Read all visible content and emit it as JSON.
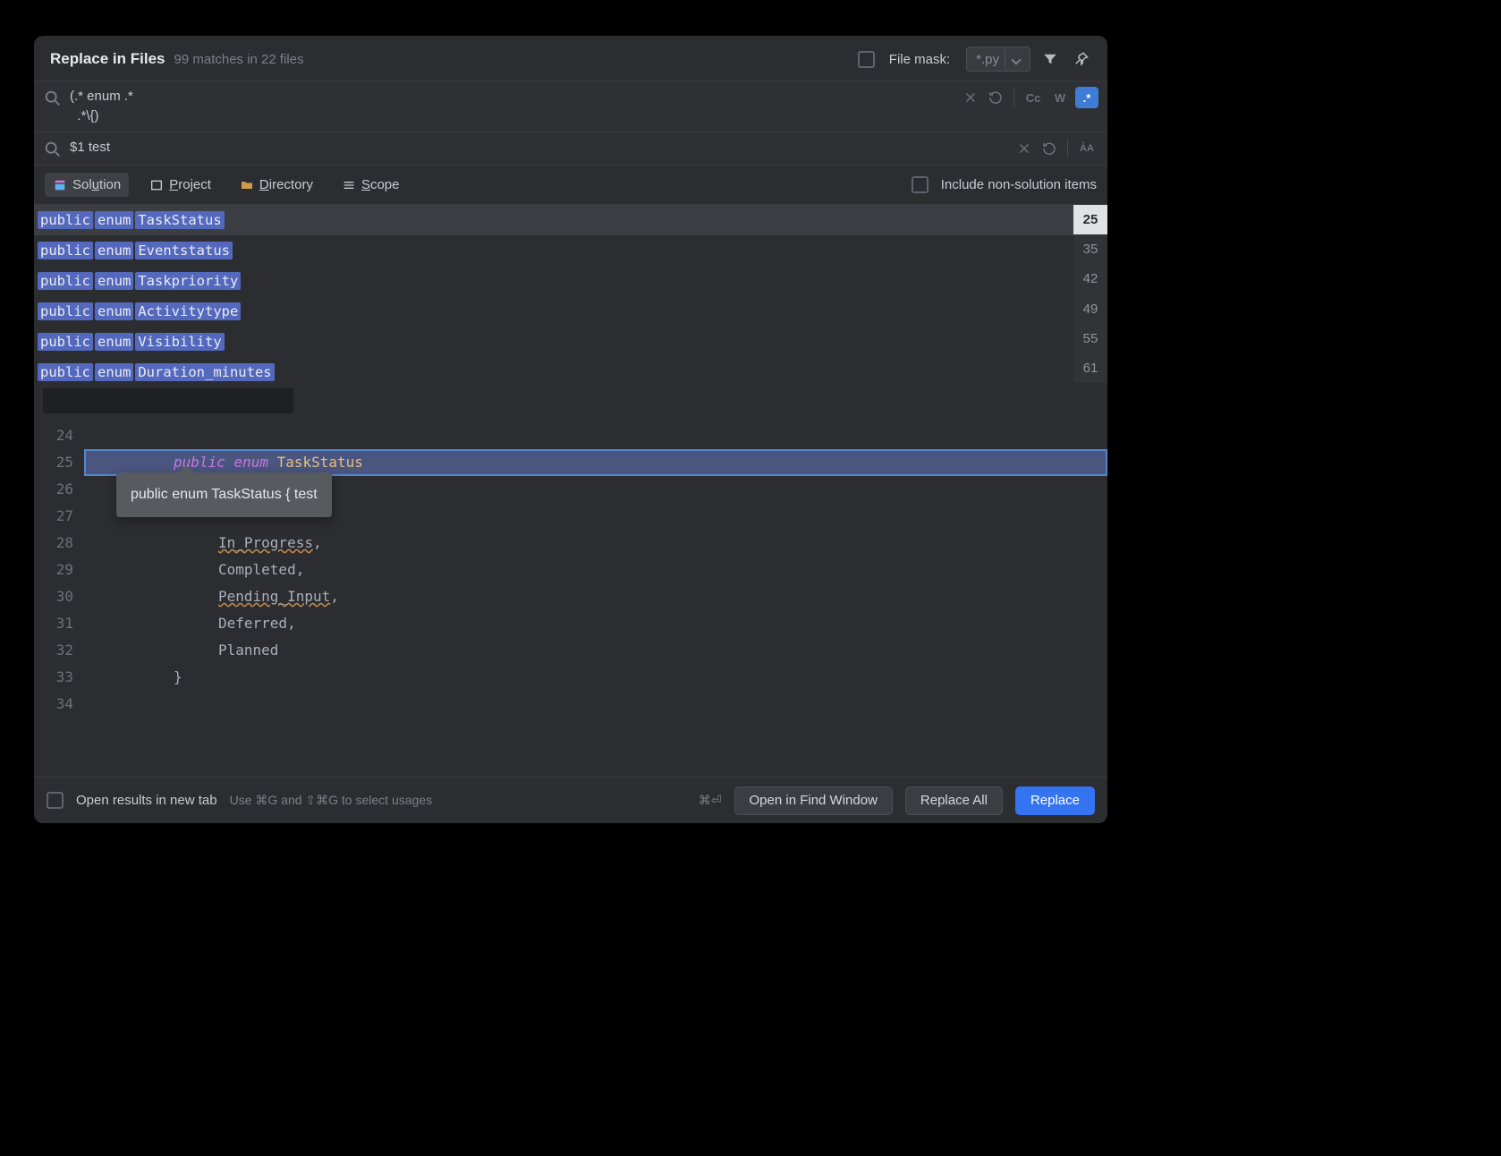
{
  "header": {
    "title": "Replace in Files",
    "subtitle": "99 matches in 22 files",
    "filemask_label": "File mask:",
    "filemask_value": "*.py"
  },
  "search": {
    "query": "(.* enum .*\n  .*\\{)",
    "toggles": {
      "cc": "Cc",
      "w": "W",
      "regex": ".*"
    }
  },
  "replace": {
    "value": "$1 test",
    "toggles": {
      "aa": "A͛A"
    }
  },
  "scopes": {
    "solution": "Solution",
    "project": "Project",
    "directory": "Directory",
    "scope": "Scope",
    "include_nonsolution": "Include non-solution items"
  },
  "results": [
    {
      "segments": [
        "public",
        "enum",
        "TaskStatus"
      ],
      "line": "25",
      "selected": true
    },
    {
      "segments": [
        "public",
        "enum",
        "Eventstatus"
      ],
      "line": "35",
      "selected": false
    },
    {
      "segments": [
        "public",
        "enum",
        "Taskpriority"
      ],
      "line": "42",
      "selected": false
    },
    {
      "segments": [
        "public",
        "enum",
        "Activitytype"
      ],
      "line": "49",
      "selected": false
    },
    {
      "segments": [
        "public",
        "enum",
        "Visibility"
      ],
      "line": "55",
      "selected": false
    },
    {
      "segments": [
        "public",
        "enum",
        "Duration_minutes"
      ],
      "line": "61",
      "selected": false
    }
  ],
  "editor": {
    "tooltip": "public enum TaskStatus { test",
    "lines": [
      {
        "num": "24",
        "html": ""
      },
      {
        "num": "25",
        "indent": 1,
        "kw": "public",
        "kw2": "enum",
        "ty": "TaskStatus",
        "hl": true
      },
      {
        "num": "26",
        "indent": 1,
        "html": ""
      },
      {
        "num": "27",
        "indent": 2
      },
      {
        "num": "28",
        "indent": 2,
        "id": "In_Progress",
        "ul": true,
        "comma": true
      },
      {
        "num": "29",
        "indent": 2,
        "id": "Completed",
        "comma": true
      },
      {
        "num": "30",
        "indent": 2,
        "id": "Pending_Input",
        "ul": true,
        "comma": true
      },
      {
        "num": "31",
        "indent": 2,
        "id": "Deferred",
        "comma": true
      },
      {
        "num": "32",
        "indent": 2,
        "id": "Planned"
      },
      {
        "num": "33",
        "indent": 1,
        "brace": "}"
      },
      {
        "num": "34",
        "html": ""
      }
    ]
  },
  "footer": {
    "open_results": "Open results in new tab",
    "hint": "Use ⌘G and ⇧⌘G to select usages",
    "shortcut": "⌘⏎",
    "open_window": "Open in Find Window",
    "replace_all": "Replace All",
    "replace": "Replace"
  }
}
